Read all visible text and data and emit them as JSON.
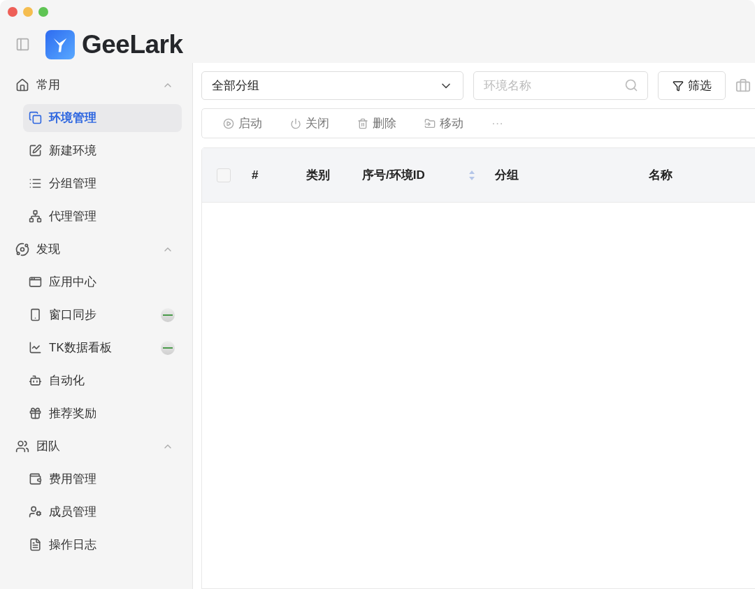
{
  "app": {
    "logo_text": "GeeLark"
  },
  "sidebar": {
    "sections": [
      {
        "label": "常用",
        "expanded": true,
        "items": [
          {
            "label": "环境管理",
            "selected": true,
            "badge": false
          },
          {
            "label": "新建环境",
            "selected": false,
            "badge": false
          },
          {
            "label": "分组管理",
            "selected": false,
            "badge": false
          },
          {
            "label": "代理管理",
            "selected": false,
            "badge": false
          }
        ]
      },
      {
        "label": "发现",
        "expanded": true,
        "items": [
          {
            "label": "应用中心",
            "selected": false,
            "badge": false
          },
          {
            "label": "窗口同步",
            "selected": false,
            "badge": true
          },
          {
            "label": "TK数据看板",
            "selected": false,
            "badge": true
          },
          {
            "label": "自动化",
            "selected": false,
            "badge": false
          },
          {
            "label": "推荐奖励",
            "selected": false,
            "badge": false
          }
        ]
      },
      {
        "label": "团队",
        "expanded": true,
        "items": [
          {
            "label": "费用管理",
            "selected": false,
            "badge": false
          },
          {
            "label": "成员管理",
            "selected": false,
            "badge": false
          },
          {
            "label": "操作日志",
            "selected": false,
            "badge": false
          }
        ]
      }
    ]
  },
  "filters": {
    "group_select": "全部分组",
    "search": {
      "placeholder": "环境名称"
    },
    "filter_button": "筛选"
  },
  "actions": [
    "启动",
    "关闭",
    "删除",
    "移动",
    "···"
  ],
  "table": {
    "select_all": {
      "checked": false
    },
    "columns": [
      {
        "label": "#",
        "sortable": false
      },
      {
        "label": "类别",
        "sortable": false
      },
      {
        "label": "序号/环境ID",
        "sortable": true
      },
      {
        "label": "分组",
        "sortable": false
      },
      {
        "label": "名称",
        "sortable": false
      }
    ]
  }
}
